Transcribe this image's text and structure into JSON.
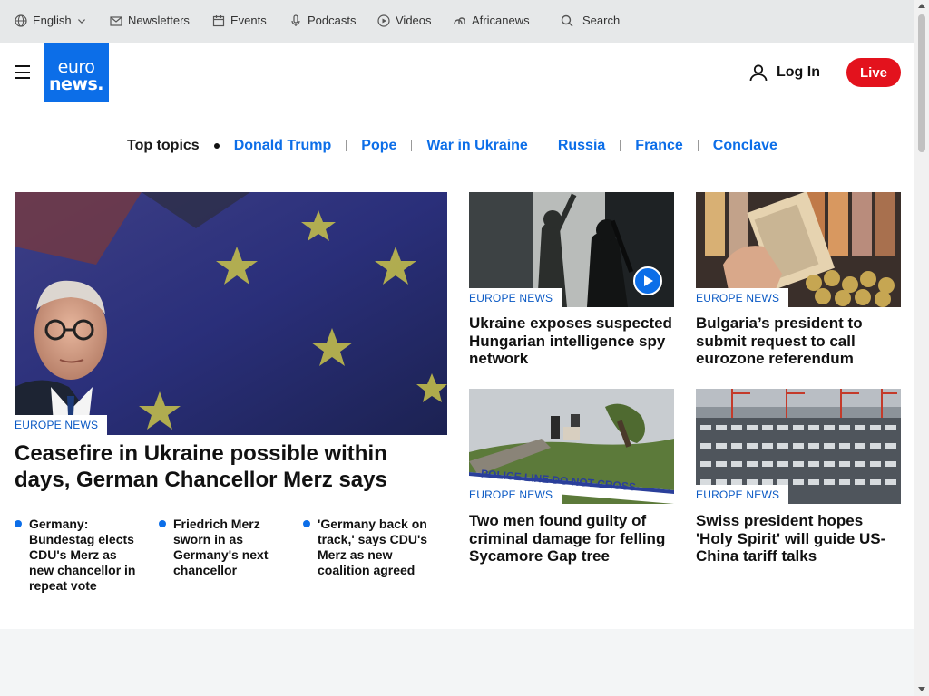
{
  "utility": {
    "language": "English",
    "newsletters": "Newsletters",
    "events": "Events",
    "podcasts": "Podcasts",
    "videos": "Videos",
    "africanews": "Africanews",
    "search": "Search"
  },
  "header": {
    "logo_line1": "euro",
    "logo_line2": "news.",
    "login": "Log In",
    "live": "Live"
  },
  "topics": {
    "label": "Top topics",
    "items": [
      "Donald Trump",
      "Pope",
      "War in Ukraine",
      "Russia",
      "France",
      "Conclave"
    ]
  },
  "hero": {
    "tag": "EUROPE NEWS",
    "title": "Ceasefire in Ukraine possible within days, German Chancellor Merz says",
    "bullets": [
      "Germany: Bundestag elects CDU's Merz as new chancellor in repeat vote",
      "Friedrich Merz sworn in as Germany's next chancellor",
      "'Germany back on track,' says CDU's Merz as new coalition agreed"
    ]
  },
  "cards": [
    {
      "tag": "EUROPE NEWS",
      "title": "Ukraine exposes suspected Hungarian intelligence spy network",
      "video": true
    },
    {
      "tag": "EUROPE NEWS",
      "title": "Bulgaria’s president to submit request to call eurozone referendum",
      "video": false
    },
    {
      "tag": "EUROPE NEWS",
      "title": "Two men found guilty of criminal damage for felling Sycamore Gap tree",
      "video": false,
      "tape_text": "POLICE LINE DO NOT CROSS"
    },
    {
      "tag": "EUROPE NEWS",
      "title": "Swiss president hopes 'Holy Spirit' will guide US-China tariff talks",
      "video": false
    }
  ],
  "colors": {
    "brand": "#0c6ee8",
    "live": "#e3121d"
  }
}
